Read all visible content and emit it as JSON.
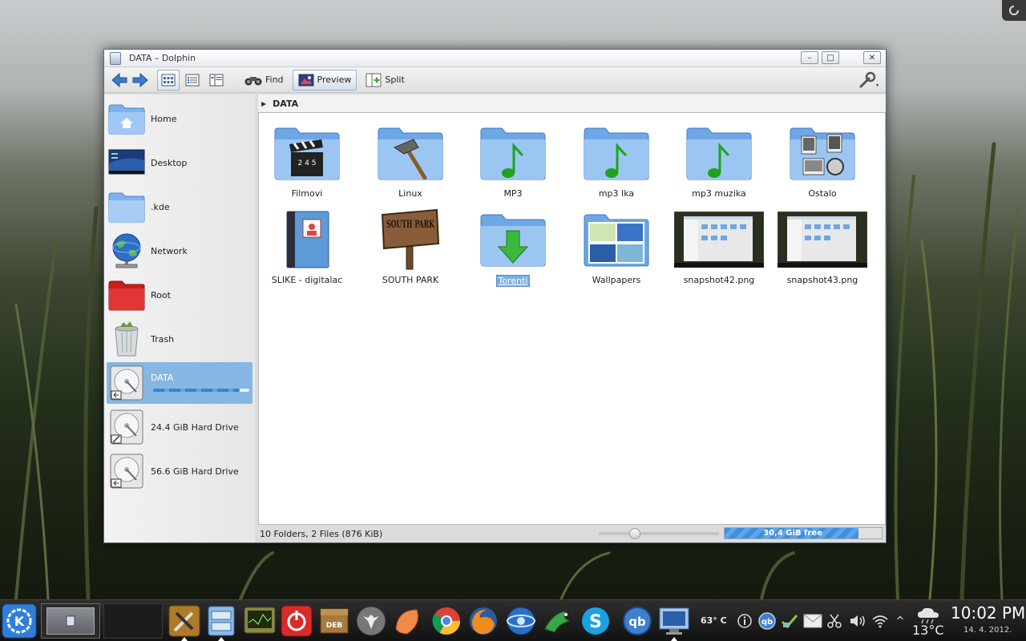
{
  "window": {
    "title": "DATA – Dolphin",
    "minimize_glyph": "–",
    "maximize_glyph": "□",
    "close_glyph": "✕"
  },
  "toolbar": {
    "find_label": "Find",
    "preview_label": "Preview",
    "split_label": "Split"
  },
  "places": [
    {
      "label": "Home",
      "icon": "home-folder-icon"
    },
    {
      "label": "Desktop",
      "icon": "desktop-icon"
    },
    {
      "label": ".kde",
      "icon": "folder-icon"
    },
    {
      "label": "Network",
      "icon": "network-globe-icon"
    },
    {
      "label": "Root",
      "icon": "red-folder-icon"
    },
    {
      "label": "Trash",
      "icon": "trash-icon"
    },
    {
      "label": "DATA",
      "icon": "hard-drive-icon",
      "capacity_used": 0.9
    },
    {
      "label": "24.4 GiB Hard Drive",
      "icon": "hard-drive-icon"
    },
    {
      "label": "56.6 GiB Hard Drive",
      "icon": "hard-drive-icon"
    }
  ],
  "breadcrumb": {
    "current": "DATA"
  },
  "items": [
    {
      "label": "Filmovi",
      "icon": "movie-folder-icon"
    },
    {
      "label": "Linux",
      "icon": "hammer-folder-icon"
    },
    {
      "label": "MP3",
      "icon": "music-folder-icon"
    },
    {
      "label": "mp3 Ika",
      "icon": "music-folder-icon"
    },
    {
      "label": "mp3 muzika",
      "icon": "music-folder-icon"
    },
    {
      "label": "Ostalo",
      "icon": "photos-folder-icon"
    },
    {
      "label": "SLIKE - digitalac",
      "icon": "book-folder-icon"
    },
    {
      "label": "SOUTH PARK",
      "icon": "south-park-sign-icon",
      "sign_text": "SOUTH PARK"
    },
    {
      "label": "Torenti",
      "icon": "download-folder-icon",
      "selected": true
    },
    {
      "label": "Wallpapers",
      "icon": "wallpapers-folder-icon"
    },
    {
      "label": "snapshot42.png",
      "icon": "screenshot-thumbnail"
    },
    {
      "label": "snapshot43.png",
      "icon": "screenshot-thumbnail"
    }
  ],
  "status": {
    "summary": "10 Folders, 2 Files (876 KiB)",
    "free_space": "30,4 GiB free",
    "used_fraction": 0.85,
    "zoom_fraction": 0.3
  },
  "panel": {
    "launchers": [
      "tools-icon",
      "file-manager-icon",
      "system-monitor-icon",
      "shutdown-icon",
      "deb-package-icon",
      "wolf-icon",
      "orange-app-icon",
      "chrome-icon",
      "firefox-icon",
      "globe-app-icon",
      "bird-app-icon",
      "skype-icon",
      "qbittorrent-icon",
      "remote-desktop-icon"
    ],
    "cpu_temp": "63° C",
    "weather_temp": "13°C",
    "clock_time": "10:02 PM",
    "clock_date": "14. 4. 2012.",
    "tray_up_glyph": "^"
  },
  "colors": {
    "selection": "#86b7e3",
    "capacity": "#3e8fdc",
    "panel": "#1c1c1c"
  }
}
